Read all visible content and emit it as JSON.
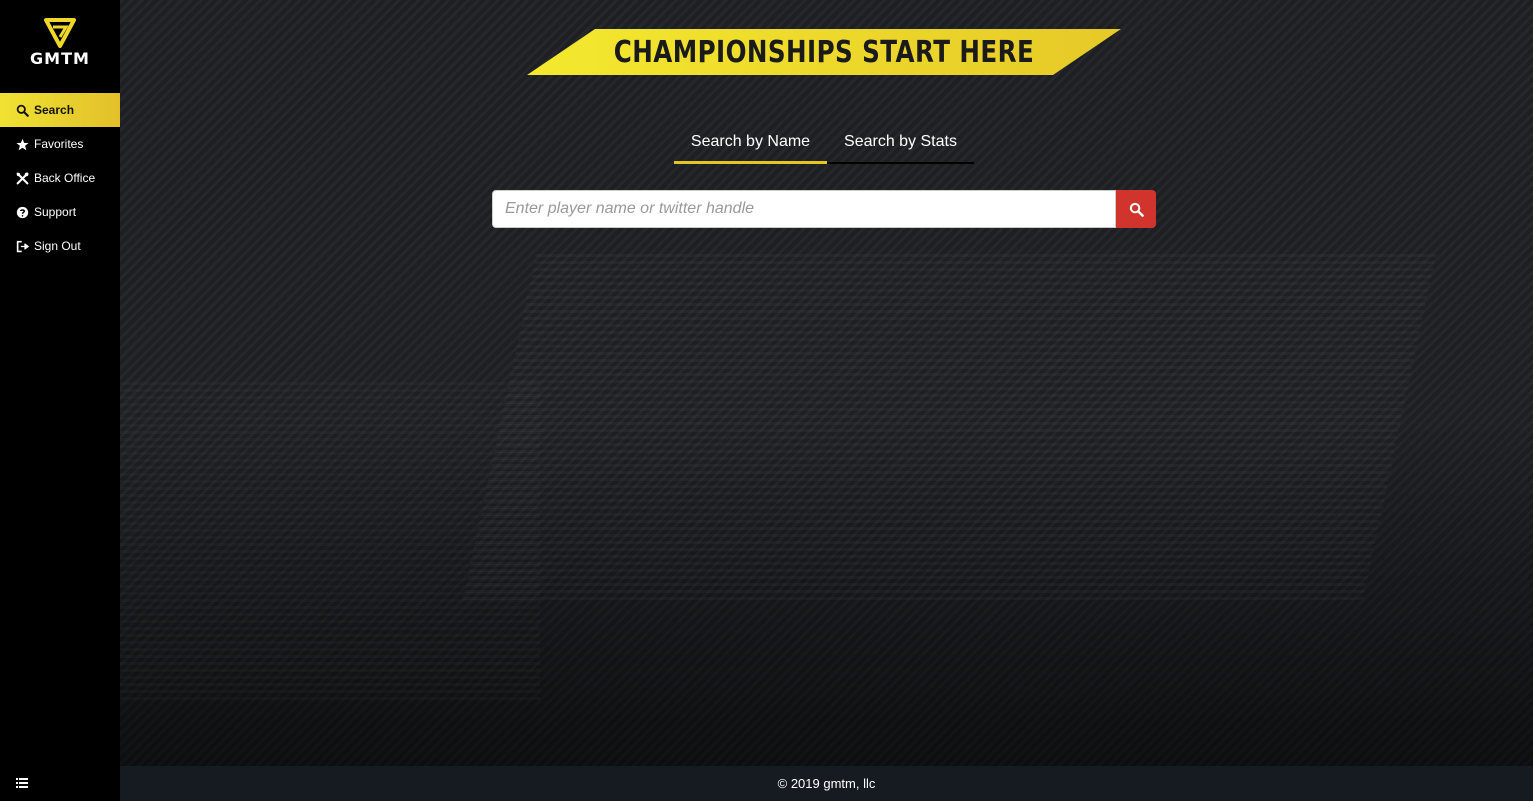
{
  "brand": {
    "name": "GMTM",
    "accent": "#e6c51e",
    "logo_icon": "gmtm-v-logo-icon"
  },
  "sidebar": {
    "items": [
      {
        "label": "Search",
        "icon": "search-icon",
        "active": true
      },
      {
        "label": "Favorites",
        "icon": "star-icon",
        "active": false
      },
      {
        "label": "Back Office",
        "icon": "tools-icon",
        "active": false
      },
      {
        "label": "Support",
        "icon": "question-circle-icon",
        "active": false
      },
      {
        "label": "Sign Out",
        "icon": "sign-out-icon",
        "active": false
      }
    ],
    "toggle_icon": "list-icon"
  },
  "main": {
    "banner_title": "CHAMPIONSHIPS START HERE",
    "tabs": [
      {
        "label": "Search by Name",
        "active": true
      },
      {
        "label": "Search by Stats",
        "active": false
      }
    ],
    "search": {
      "value": "",
      "placeholder": "Enter player name or twitter handle",
      "button_icon": "search-icon",
      "button_color": "#d0342c"
    }
  },
  "footer": {
    "text": "© 2019 gmtm, llc"
  }
}
